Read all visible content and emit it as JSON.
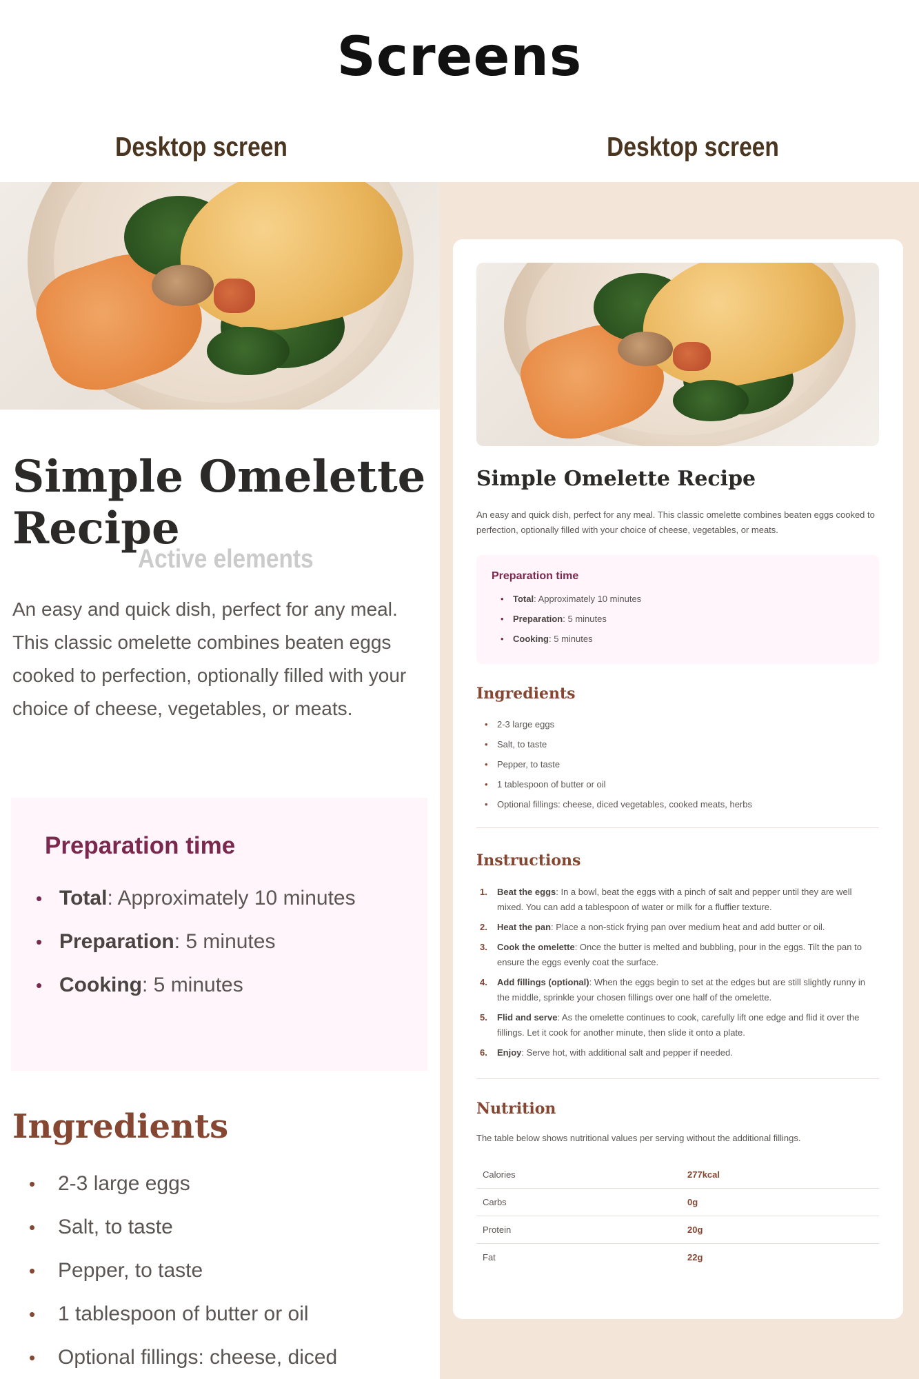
{
  "page": {
    "title": "Screens",
    "left_heading": "Desktop screen",
    "right_heading": "Desktop screen",
    "overlay_label": "Active elements"
  },
  "recipe": {
    "title": "Simple Omelette Recipe",
    "description": "An easy and quick dish, perfect for any meal. This classic omelette combines beaten eggs cooked to perfection, optionally filled with your choice of cheese, vegetables, or meats.",
    "preparation": {
      "title": "Preparation time",
      "items": [
        {
          "label": "Total",
          "value": ": Approximately 10 minutes"
        },
        {
          "label": "Preparation",
          "value": ": 5 minutes"
        },
        {
          "label": "Cooking",
          "value": ": 5 minutes"
        }
      ]
    },
    "ingredients": {
      "title": "Ingredients",
      "items": [
        "2-3 large eggs",
        "Salt, to taste",
        "Pepper, to taste",
        "1 tablespoon of butter or oil",
        "Optional fillings: cheese, diced vegetables, cooked meats, herbs"
      ],
      "left_cut_item": "Optional fillings: cheese, diced"
    },
    "instructions": {
      "title": "Instructions",
      "steps": [
        {
          "num": "1.",
          "label": "Beat the eggs",
          "text": ": In a bowl, beat the eggs with a pinch of salt and pepper until they are well mixed. You can add a tablespoon of water or milk for a fluffier texture."
        },
        {
          "num": "2.",
          "label": "Heat the pan",
          "text": ": Place a non-stick frying pan over medium heat and add butter or oil."
        },
        {
          "num": "3.",
          "label": "Cook the omelette",
          "text": ": Once the butter is melted and bubbling, pour in the eggs. Tilt the pan to ensure the eggs evenly coat the surface."
        },
        {
          "num": "4.",
          "label": "Add fillings (optional)",
          "text": ": When the eggs begin to set at the edges but are still slightly runny in the middle, sprinkle your chosen fillings over one half of the omelette."
        },
        {
          "num": "5.",
          "label": "Flid and serve",
          "text": ": As the omelette continues to cook, carefully lift one edge and flid it over the fillings. Let it cook for another minute, then slide it onto a plate."
        },
        {
          "num": "6.",
          "label": "Enjoy",
          "text": ": Serve hot, with additional salt and pepper if needed."
        }
      ]
    },
    "nutrition": {
      "title": "Nutrition",
      "description": "The table below shows nutritional values per serving without the additional fillings.",
      "rows": [
        {
          "label": "Calories",
          "value": "277kcal"
        },
        {
          "label": "Carbs",
          "value": "0g"
        },
        {
          "label": "Protein",
          "value": "20g"
        },
        {
          "label": "Fat",
          "value": "22g"
        }
      ]
    }
  },
  "colors": {
    "accent_brown": "#854632",
    "accent_plum": "#7a284e",
    "page_bg": "#f3e5d8",
    "prep_bg": "#fff5fa"
  }
}
